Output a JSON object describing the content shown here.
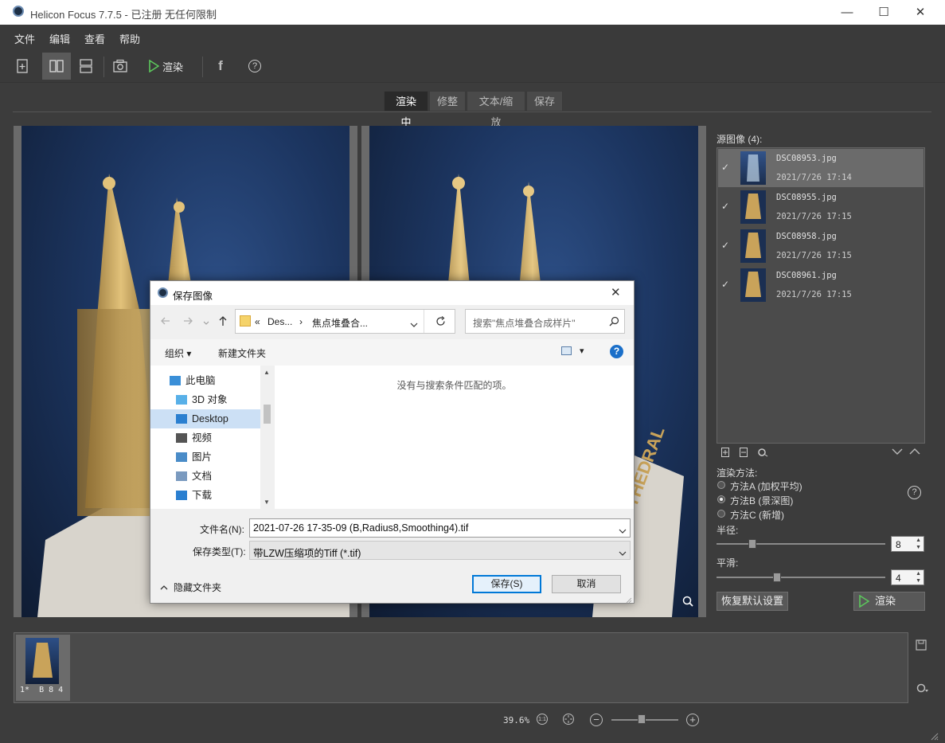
{
  "window": {
    "title": "Helicon Focus 7.7.5 - 已注册  无任何限制",
    "controls": {
      "minimize": "—",
      "maximize": "☐",
      "close": "✕"
    }
  },
  "menu": [
    "文件",
    "编辑",
    "查看",
    "帮助"
  ],
  "toolbar": {
    "render_label": "渲染",
    "facebook_glyph": "f",
    "help_glyph": "?"
  },
  "tabs": [
    {
      "label": "渲染中",
      "active": true
    },
    {
      "label": "修整",
      "active": false
    },
    {
      "label": "文本/缩放",
      "active": false
    },
    {
      "label": "保存",
      "active": false
    }
  ],
  "source_panel": {
    "label": "源图像 (4):",
    "items": [
      {
        "name": "DSC08953.jpg",
        "date": "2021/7/26 17:14",
        "checked": true,
        "selected": true
      },
      {
        "name": "DSC08955.jpg",
        "date": "2021/7/26 17:15",
        "checked": true,
        "selected": false
      },
      {
        "name": "DSC08958.jpg",
        "date": "2021/7/26 17:15",
        "checked": true,
        "selected": false
      },
      {
        "name": "DSC08961.jpg",
        "date": "2021/7/26 17:15",
        "checked": true,
        "selected": false
      }
    ],
    "check_glyph": "✓"
  },
  "render_settings": {
    "method_label": "渲染方法:",
    "methods": [
      {
        "label": "方法A (加权平均)",
        "selected": false
      },
      {
        "label": "方法B (景深图)",
        "selected": true
      },
      {
        "label": "方法C (新增)",
        "selected": false
      }
    ],
    "radius_label": "半径:",
    "radius_value": "8",
    "radius_level": 0.2,
    "smoothing_label": "平滑:",
    "smoothing_value": "4",
    "smoothing_level": 0.35,
    "reset_label": "恢复默认设置",
    "render_label": "渲染"
  },
  "filmstrip": {
    "thumb_label": "1*  B 8 4"
  },
  "zoom": {
    "percent": "39.6%",
    "one_to_one": "1:1",
    "minus": "−",
    "plus": "+",
    "level": 0.45
  },
  "pane_right": {
    "overlay_text": "THEDRAL"
  },
  "dialog": {
    "title": "保存图像",
    "close": "✕",
    "path_prefix": "«",
    "path_1": "Des...",
    "path_sep": "›",
    "path_2": "焦点堆叠合...",
    "search_placeholder": "搜索\"焦点堆叠合成样片\"",
    "organize_label": "组织 ▾",
    "new_folder_label": "新建文件夹",
    "view_glyph": "▾",
    "help_glyph": "?",
    "nav_items": [
      {
        "label": "此电脑",
        "indent": false,
        "selected": false,
        "color": "#3a8fd8"
      },
      {
        "label": "3D 对象",
        "indent": true,
        "selected": false,
        "color": "#58b0e8"
      },
      {
        "label": "Desktop",
        "indent": true,
        "selected": true,
        "color": "#2a7fd0"
      },
      {
        "label": "视频",
        "indent": true,
        "selected": false,
        "color": "#555555"
      },
      {
        "label": "图片",
        "indent": true,
        "selected": false,
        "color": "#4a8cc8"
      },
      {
        "label": "文档",
        "indent": true,
        "selected": false,
        "color": "#7a9abf"
      },
      {
        "label": "下载",
        "indent": true,
        "selected": false,
        "color": "#2a7fd0"
      }
    ],
    "empty_message": "没有与搜索条件匹配的项。",
    "filename_label": "文件名(N):",
    "filename_value": "2021-07-26 17-35-09 (B,Radius8,Smoothing4).tif",
    "filetype_label": "保存类型(T):",
    "filetype_value": "带LZW压缩项的Tiff (*.tif)",
    "hide_folders_label": "隐藏文件夹",
    "save_label": "保存(S)",
    "cancel_label": "取消"
  }
}
